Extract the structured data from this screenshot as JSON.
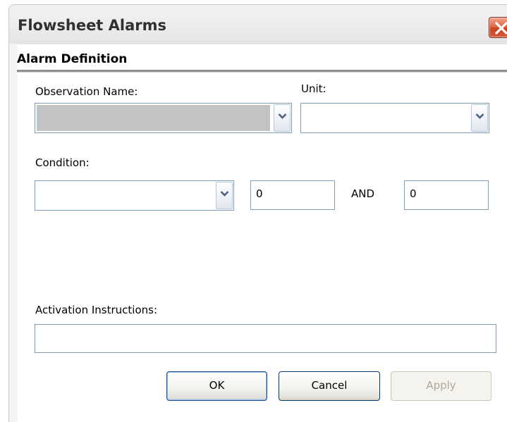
{
  "window": {
    "title": "Flowsheet Alarms",
    "close_icon": "close-icon"
  },
  "section": {
    "title": "Alarm Definition"
  },
  "observation": {
    "label": "Observation Name:",
    "value": ""
  },
  "unit": {
    "label": "Unit:",
    "value": ""
  },
  "condition": {
    "label": "Condition:",
    "value": "",
    "min_value": "0",
    "and_label": "AND",
    "max_value": "0"
  },
  "activation": {
    "label": "Activation Instructions:",
    "value": ""
  },
  "buttons": {
    "ok": "OK",
    "cancel": "Cancel",
    "apply": "Apply"
  },
  "colors": {
    "close_red": "#d85a36",
    "field_border": "#7f9db9",
    "disabled_text": "#aca899"
  }
}
